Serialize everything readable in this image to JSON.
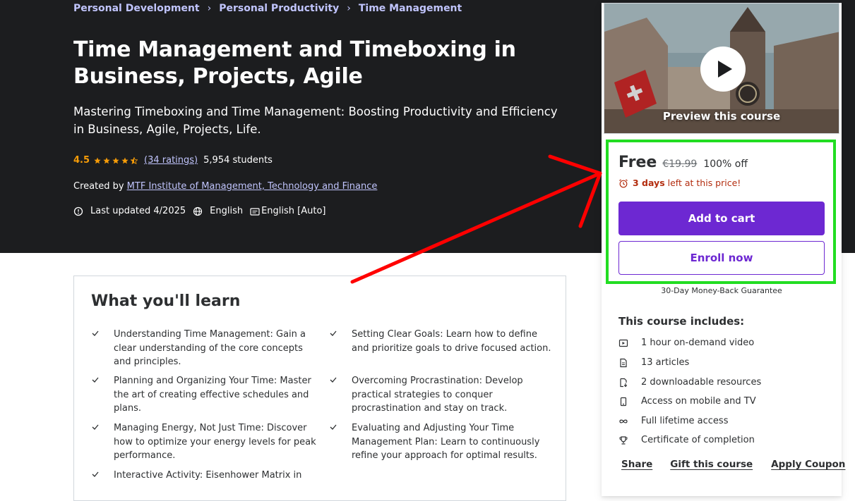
{
  "breadcrumb": [
    "Personal Development",
    "Personal Productivity",
    "Time Management"
  ],
  "course": {
    "title": "Time Management and Timeboxing in Business, Projects, Agile",
    "subtitle": "Mastering Timeboxing and Time Management: Boosting Productivity and Efficiency in Business, Agile, Projects, Life.",
    "rating": "4.5",
    "rating_value": 4.5,
    "ratings_count": "(34 ratings)",
    "students": "5,954 students",
    "created_by_label": "Created by",
    "instructor": "MTF Institute of Management, Technology and Finance",
    "last_updated": "Last updated 4/2025",
    "language": "English",
    "captions": "English [Auto]"
  },
  "learn": {
    "heading": "What you'll learn",
    "items": [
      "Understanding Time Management: Gain a clear understanding of the core concepts and principles.",
      "Setting Clear Goals: Learn how to define and prioritize goals to drive focused action.",
      "Planning and Organizing Your Time: Master the art of creating effective schedules and plans.",
      "Overcoming Procrastination: Develop practical strategies to conquer procrastination and stay on track.",
      "Managing Energy, Not Just Time: Discover how to optimize your energy levels for peak performance.",
      "Evaluating and Adjusting Your Time Management Plan: Learn to continuously refine your approach for optimal results.",
      "Interactive Activity: Eisenhower Matrix in"
    ]
  },
  "card": {
    "preview_label": "Preview this course",
    "price": "Free",
    "original_price": "€19.99",
    "discount": "100% off",
    "timer_days": "3 days",
    "timer_rest": "left at this price!",
    "add_to_cart": "Add to cart",
    "enroll_now": "Enroll now",
    "guarantee": "30-Day Money-Back Guarantee",
    "includes_title": "This course includes:",
    "includes": [
      {
        "icon": "video-icon",
        "label": "1 hour on-demand video"
      },
      {
        "icon": "article-icon",
        "label": "13 articles"
      },
      {
        "icon": "download-file-icon",
        "label": "2 downloadable resources"
      },
      {
        "icon": "mobile-icon",
        "label": "Access on mobile and TV"
      },
      {
        "icon": "infinity-icon",
        "label": "Full lifetime access"
      },
      {
        "icon": "trophy-icon",
        "label": "Certificate of completion"
      }
    ],
    "links": [
      "Share",
      "Gift this course",
      "Apply Coupon"
    ]
  },
  "colors": {
    "hero_bg": "#1c1d1f",
    "accent_purple": "#6d28d2",
    "link_lavender": "#c0c4fc",
    "star_orange": "#f69c08",
    "timer_red": "#b32d0f",
    "annotation_green": "#22dd22",
    "annotation_red": "#ff0000"
  }
}
